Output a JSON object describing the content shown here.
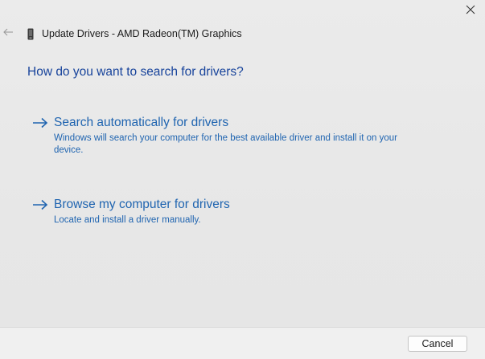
{
  "window": {
    "title": "Update Drivers - AMD Radeon(TM) Graphics"
  },
  "heading": "How do you want to search for drivers?",
  "options": [
    {
      "title": "Search automatically for drivers",
      "description": "Windows will search your computer for the best available driver and install it on your device."
    },
    {
      "title": "Browse my computer for drivers",
      "description": "Locate and install a driver manually."
    }
  ],
  "footer": {
    "cancel_label": "Cancel"
  },
  "icons": {
    "close": "close-icon",
    "back": "back-arrow-icon",
    "device": "device-icon",
    "option_arrow": "arrow-right-icon"
  },
  "colors": {
    "link_blue": "#1f64b0",
    "heading_blue": "#17439b"
  }
}
